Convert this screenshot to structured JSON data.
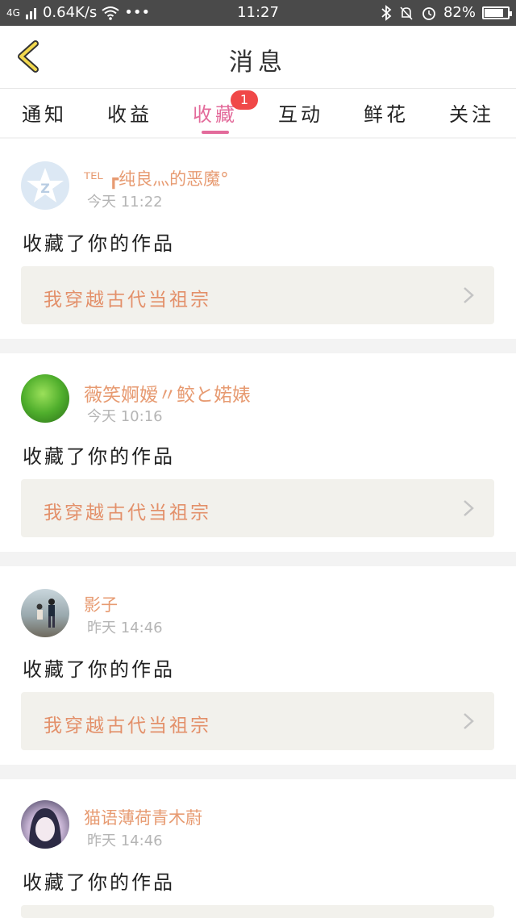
{
  "status_bar": {
    "signal": "4G",
    "speed": "0.64K/s",
    "dots": "•••",
    "time": "11:27",
    "battery_text": "82%",
    "battery_level": 0.82
  },
  "header": {
    "title": "消息",
    "back_icon": "chevron-left-icon"
  },
  "tabs": [
    {
      "label": "通知",
      "active": false
    },
    {
      "label": "收益",
      "active": false
    },
    {
      "label": "收藏",
      "active": true,
      "badge": "1"
    },
    {
      "label": "互动",
      "active": false
    },
    {
      "label": "鲜花",
      "active": false
    },
    {
      "label": "关注",
      "active": false
    }
  ],
  "messages": [
    {
      "username": "ᵀᴱᴸ ┏纯良灬的恶魔°",
      "time": "今天 11:22",
      "action": "收藏了你的作品",
      "work_title": "我穿越古代当祖宗"
    },
    {
      "username": "薇笑婀嫒〃鲛と婼婊",
      "time": "今天 10:16",
      "action": "收藏了你的作品",
      "work_title": "我穿越古代当祖宗"
    },
    {
      "username": "影子",
      "time": "昨天 14:46",
      "action": "收藏了你的作品",
      "work_title": "我穿越古代当祖宗"
    },
    {
      "username": "猫语薄荷青木蔚",
      "time": "昨天 14:46",
      "action": "收藏了你的作品",
      "work_title": ""
    }
  ],
  "colors": {
    "accent": "#e36b9b",
    "username": "#e79b72",
    "work_title": "#e3906a",
    "badge": "#f04848"
  }
}
